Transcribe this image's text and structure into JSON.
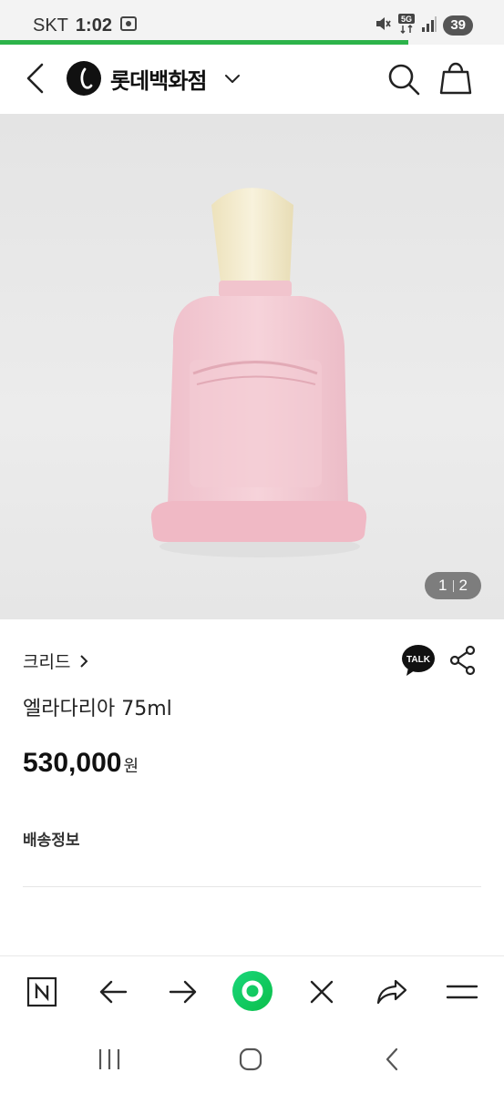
{
  "status_bar": {
    "carrier": "SKT",
    "time": "1:02",
    "battery": "39",
    "network": "5G",
    "icons": [
      "screenshot-icon",
      "mute-icon",
      "5g-data-icon",
      "signal-icon"
    ]
  },
  "page_load_progress": 0.81,
  "header": {
    "brand_name": "롯데백화점",
    "icons": {
      "back": "back-arrow-icon",
      "logo": "lotte-logo-icon",
      "dropdown": "chevron-down-icon",
      "search": "search-icon",
      "bag": "shopping-bag-icon"
    }
  },
  "gallery": {
    "current": "1",
    "total": "2"
  },
  "product": {
    "brand": "크리드",
    "name": "엘라다리아 75ml",
    "price": "530,000",
    "currency": "원",
    "shipping_label": "배송정보",
    "talk_label": "TALK"
  },
  "browser_toolbar": {
    "icons": [
      "naver-n-icon",
      "back-arrow-icon",
      "forward-arrow-icon",
      "green-dot-icon",
      "close-icon",
      "share-icon",
      "menu-icon"
    ]
  },
  "system_nav": {
    "icons": [
      "recent-apps-icon",
      "home-icon",
      "system-back-icon"
    ]
  },
  "colors": {
    "accent_green": "#2db34a",
    "bottle_pink": "#f3c9d2",
    "cap_cream": "#f4ecd2"
  }
}
